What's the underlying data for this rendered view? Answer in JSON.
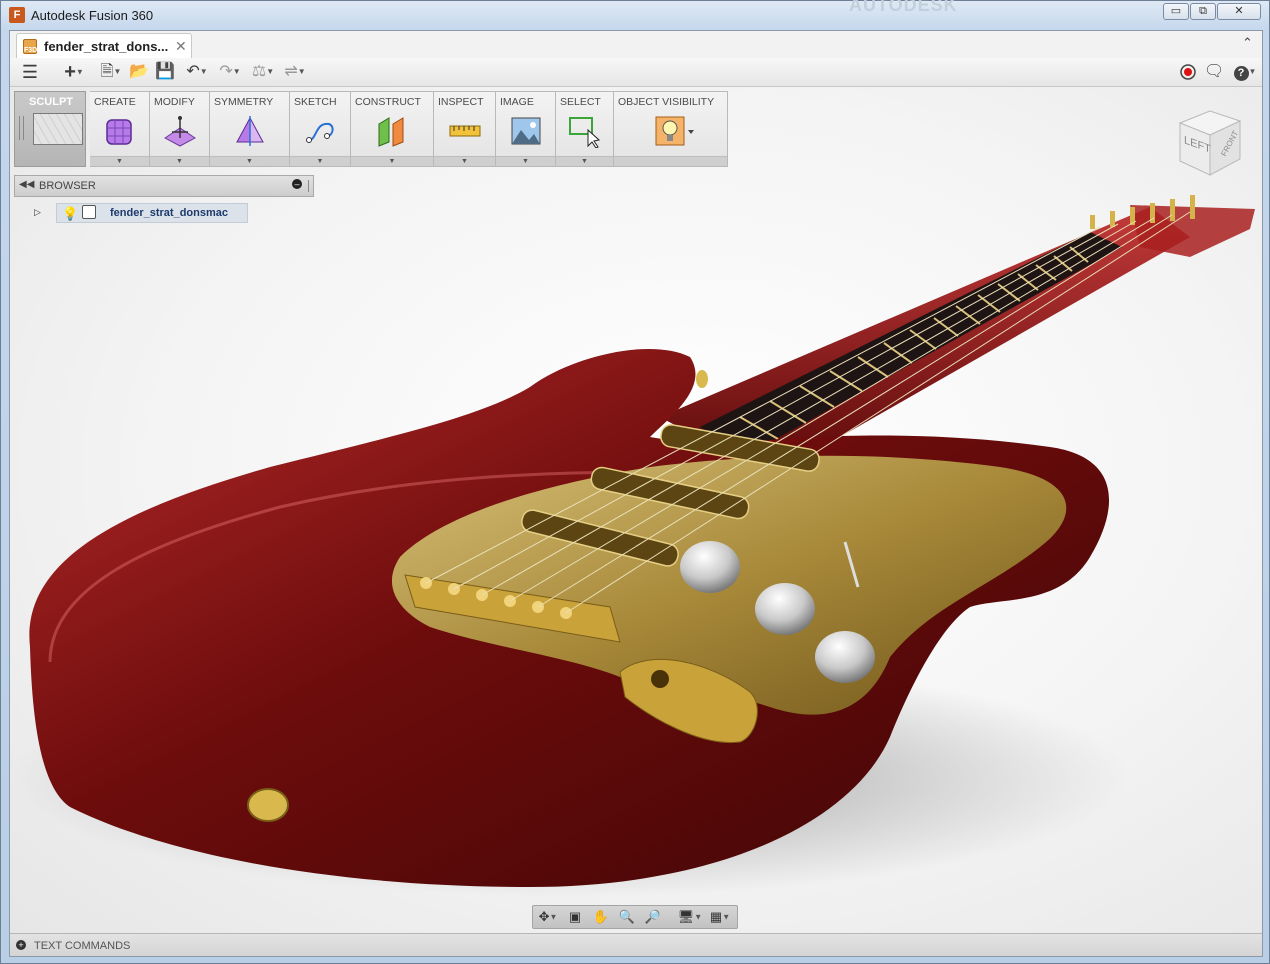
{
  "window": {
    "title": "Autodesk Fusion 360",
    "watermark": "AUTODESK",
    "controls": {
      "minimize": "▭",
      "restore": "⧉",
      "close": "✕"
    }
  },
  "tab": {
    "label": "fender_strat_dons...",
    "icon_text": "F3D",
    "close": "✕"
  },
  "ribbon": {
    "workspace": "SCULPT",
    "groups": [
      {
        "label": "CREATE",
        "icon": "create-form-icon"
      },
      {
        "label": "MODIFY",
        "icon": "edit-form-icon"
      },
      {
        "label": "SYMMETRY",
        "icon": "symmetry-icon"
      },
      {
        "label": "SKETCH",
        "icon": "sketch-spline-icon"
      },
      {
        "label": "CONSTRUCT",
        "icon": "offset-plane-icon"
      },
      {
        "label": "INSPECT",
        "icon": "measure-icon"
      },
      {
        "label": "IMAGE",
        "icon": "image-icon"
      },
      {
        "label": "SELECT",
        "icon": "select-icon"
      },
      {
        "label": "OBJECT VISIBILITY",
        "icon": "visibility-bulb-icon"
      }
    ]
  },
  "browser": {
    "title": "BROWSER",
    "root_item": "fender_strat_donsmac"
  },
  "viewcube": {
    "face_left": "LEFT",
    "face_front": "FRONT"
  },
  "text_commands": {
    "label": "TEXT COMMANDS"
  },
  "colors": {
    "guitar_body": "#8a0f0f",
    "pickguard": "#b89a3a",
    "accent": "#c9581c"
  }
}
